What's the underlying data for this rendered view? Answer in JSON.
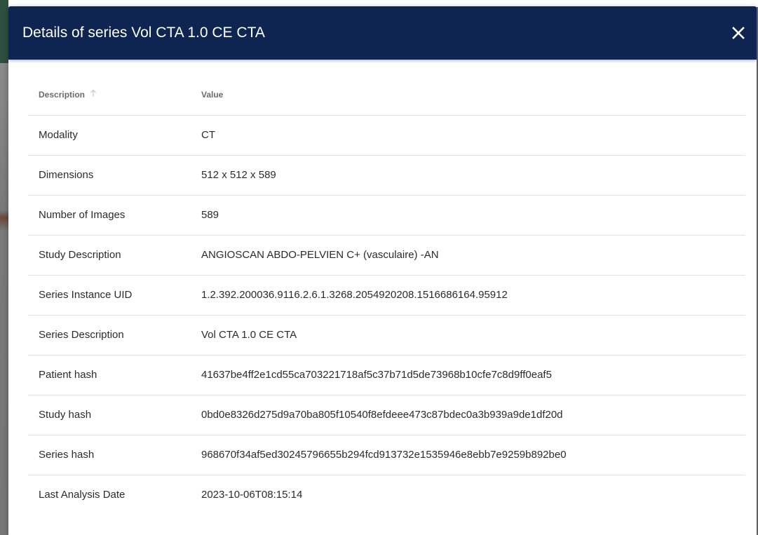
{
  "dialog": {
    "title": "Details of series Vol CTA 1.0 CE CTA",
    "close_icon": "close-icon"
  },
  "table": {
    "headers": {
      "description": "Description",
      "value": "Value",
      "sort_icon": "arrow-up-icon"
    },
    "rows": [
      {
        "description": "Modality",
        "value": "CT"
      },
      {
        "description": "Dimensions",
        "value": "512 x 512 x 589"
      },
      {
        "description": "Number of Images",
        "value": "589"
      },
      {
        "description": "Study Description",
        "value": "ANGIOSCAN ABDO-PELVIEN C+ (vasculaire) -AN"
      },
      {
        "description": "Series Instance UID",
        "value": "1.2.392.200036.9116.2.6.1.3268.2054920208.1516686164.95912"
      },
      {
        "description": "Series Description",
        "value": "Vol CTA 1.0 CE CTA"
      },
      {
        "description": "Patient hash",
        "value": "41637be4ff2e1cd55ca703221718af5c37b71d5de73968b10cfe7c8d9ff0eaf5"
      },
      {
        "description": "Study hash",
        "value": "0bd0e8326d275d9a70ba805f10540f8efdeee473c87bdec0a3b939a9de1df20d"
      },
      {
        "description": "Series hash",
        "value": "968670f34af5ed30245796655b294fcd913732e1535946e8ebb7e9259b892be0"
      },
      {
        "description": "Last Analysis Date",
        "value": "2023-10-06T08:15:14"
      }
    ]
  },
  "colors": {
    "header_bg": "#0d2550",
    "header_text": "#ffffff",
    "divider": "#e0e0e0"
  }
}
